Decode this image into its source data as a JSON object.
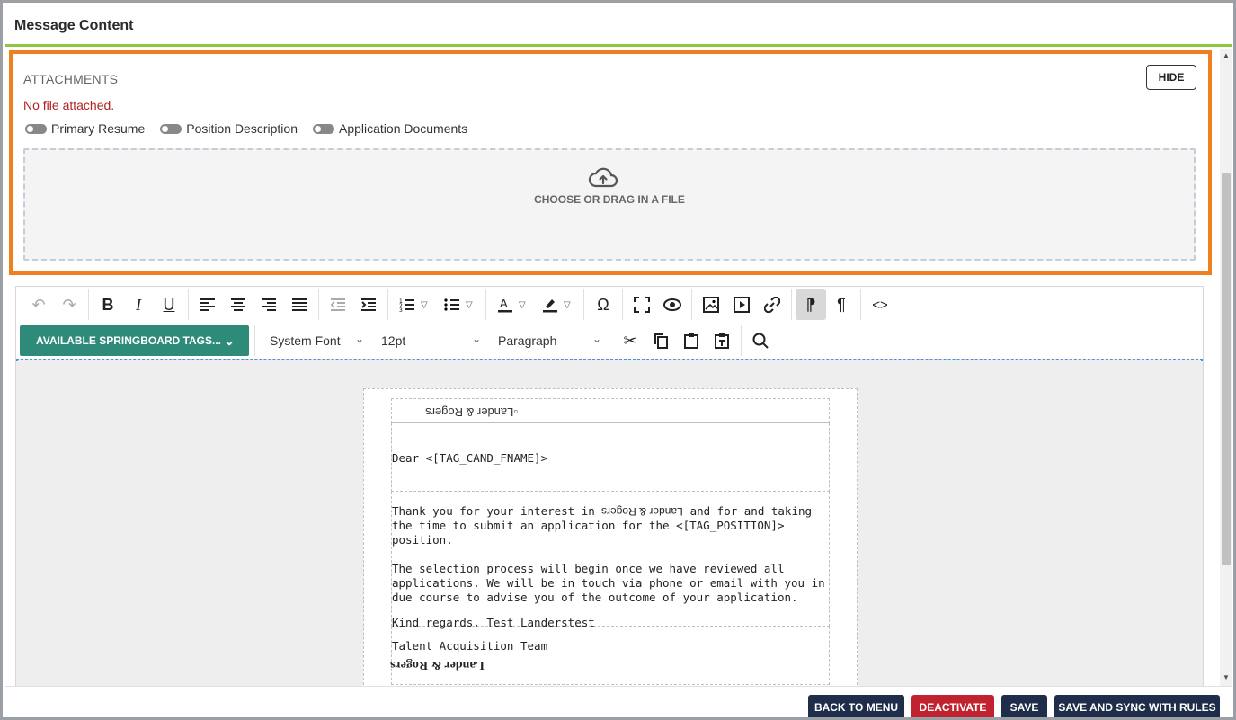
{
  "header": {
    "title": "Message Content"
  },
  "attachments": {
    "label": "ATTACHMENTS",
    "hide_label": "HIDE",
    "status": "No file attached.",
    "toggles": [
      {
        "label": "Primary Resume",
        "on": false
      },
      {
        "label": "Position Description",
        "on": false
      },
      {
        "label": "Application Documents",
        "on": false
      }
    ],
    "dropzone_label": "CHOOSE OR DRAG IN A FILE"
  },
  "toolbar": {
    "tags_label": "AVAILABLE SPRINGBOARD TAGS...",
    "font_family": "System Font",
    "font_size": "12pt",
    "block_format": "Paragraph"
  },
  "email": {
    "logo_alt": "Lander & Rogers",
    "greeting": "Dear <[TAG_CAND_FNAME]>",
    "para1_a": "Thank you for your interest in",
    "para1_company": "Lander & Rogers",
    "para1_b": "and for and taking the time to submit an application for the <[TAG_POSITION]> position.",
    "para2": "The selection process will begin once we have reviewed all applications. We will be in touch via phone or email with you in due course to advise you of the outcome of your application.",
    "regards": "Kind regards, Test Landerstest",
    "team": "Talent Acquisition Team",
    "sig_logo": "Lander & Rogers"
  },
  "footer": {
    "back_label": "BACK TO MENU",
    "deactivate_label": "DEACTIVATE",
    "save_label": "SAVE",
    "save_sync_label": "SAVE AND SYNC WITH RULES"
  },
  "colors": {
    "accent_green": "#8dc63f",
    "highlight_orange": "#f07f1f",
    "tags_button": "#2e8b7a",
    "navy_button": "#1e2d4a",
    "deactivate_red": "#c0232f",
    "error_text": "#b22222"
  }
}
